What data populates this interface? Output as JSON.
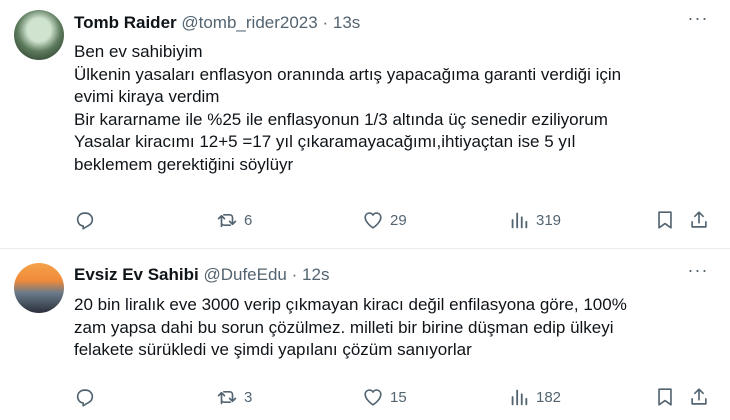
{
  "tweets": [
    {
      "name": "Tomb Raider",
      "handle": "@tomb_rider2023",
      "separator": "·",
      "time": "13s",
      "more_icon": "more-dots-icon",
      "lines": [
        "Ben ev sahibiyim",
        "Ülkenin yasaları enflasyon oranında artış yapacağıma garanti verdiği için",
        "evimi kiraya verdim",
        "Bir kararname ile %25  ile enflasyonun 1/3 altında üç senedir eziliyorum",
        "Yasalar kiracımı 12+5 =17 yıl çıkaramayacağımı,ihtiyaçtan ise 5 yıl",
        "beklemem gerektiğini söylüyr"
      ],
      "replies": "",
      "retweets": "6",
      "likes": "29",
      "views": "319"
    },
    {
      "name": "Evsiz Ev Sahibi",
      "handle": "@DufeEdu",
      "separator": "·",
      "time": "12s",
      "more_icon": "more-dots-icon",
      "lines": [
        "20 bin liralık eve 3000 verip çıkmayan kiracı değil enfilasyona göre, 100%",
        "zam yapsa dahi bu sorun çözülmez.  milleti bir birine düşman edip ülkeyi",
        "felakete sürükledi ve şimdi yapılanı çözüm sanıyorlar"
      ],
      "replies": "",
      "retweets": "3",
      "likes": "15",
      "views": "182"
    }
  ],
  "icons": {
    "reply": "reply-icon",
    "retweet": "retweet-icon",
    "like": "heart-icon",
    "views": "views-chart-icon",
    "bookmark": "bookmark-icon",
    "share": "share-icon"
  },
  "colors": {
    "text": "#0f1419",
    "secondary": "#536471",
    "divider": "#e6ecf0"
  }
}
